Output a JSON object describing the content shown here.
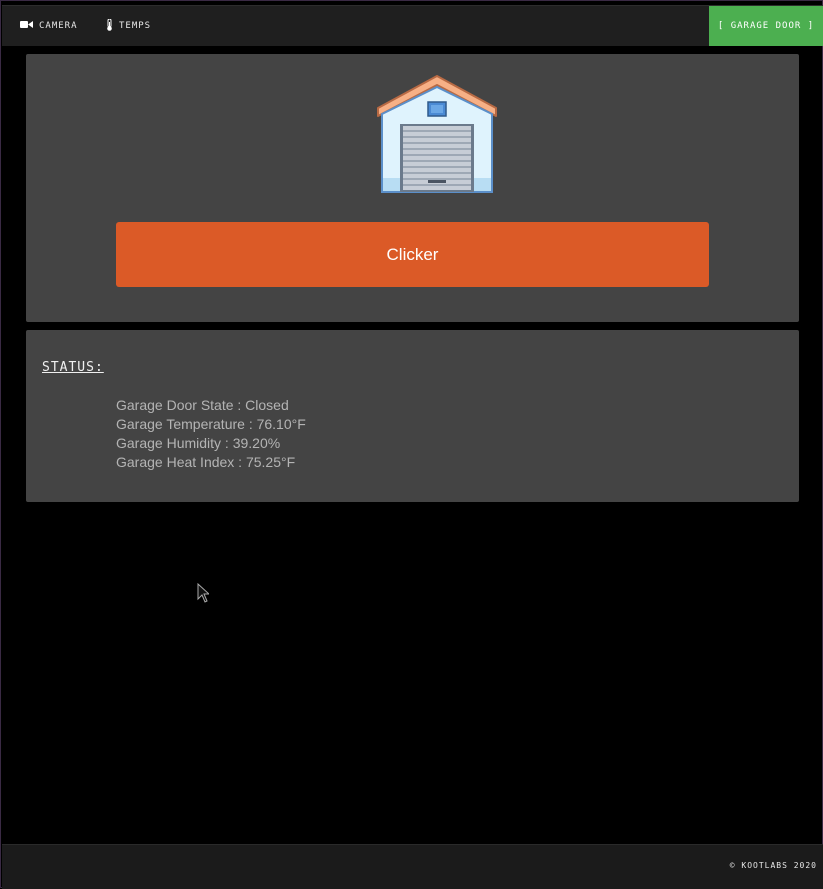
{
  "nav": {
    "camera_label": "Camera",
    "temps_label": "Temps",
    "garage_label": "[ Garage Door ]",
    "camera_icon": "video-camera-icon",
    "temps_icon": "thermometer-icon"
  },
  "main": {
    "garage_icon": "garage-door-icon",
    "clicker_label": "Clicker"
  },
  "status": {
    "title": "Status:",
    "lines": [
      "Garage Door State : Closed",
      "Garage Temperature : 76.10°F",
      "Garage Humidity : 39.20%",
      "Garage Heat Index : 75.25°F"
    ]
  },
  "footer": {
    "text": "© Kootlabs 2020"
  },
  "colors": {
    "accent_green": "#4caf50",
    "clicker_orange": "#db5a27",
    "panel_bg": "#444444",
    "bar_bg": "#1f1f1f"
  }
}
